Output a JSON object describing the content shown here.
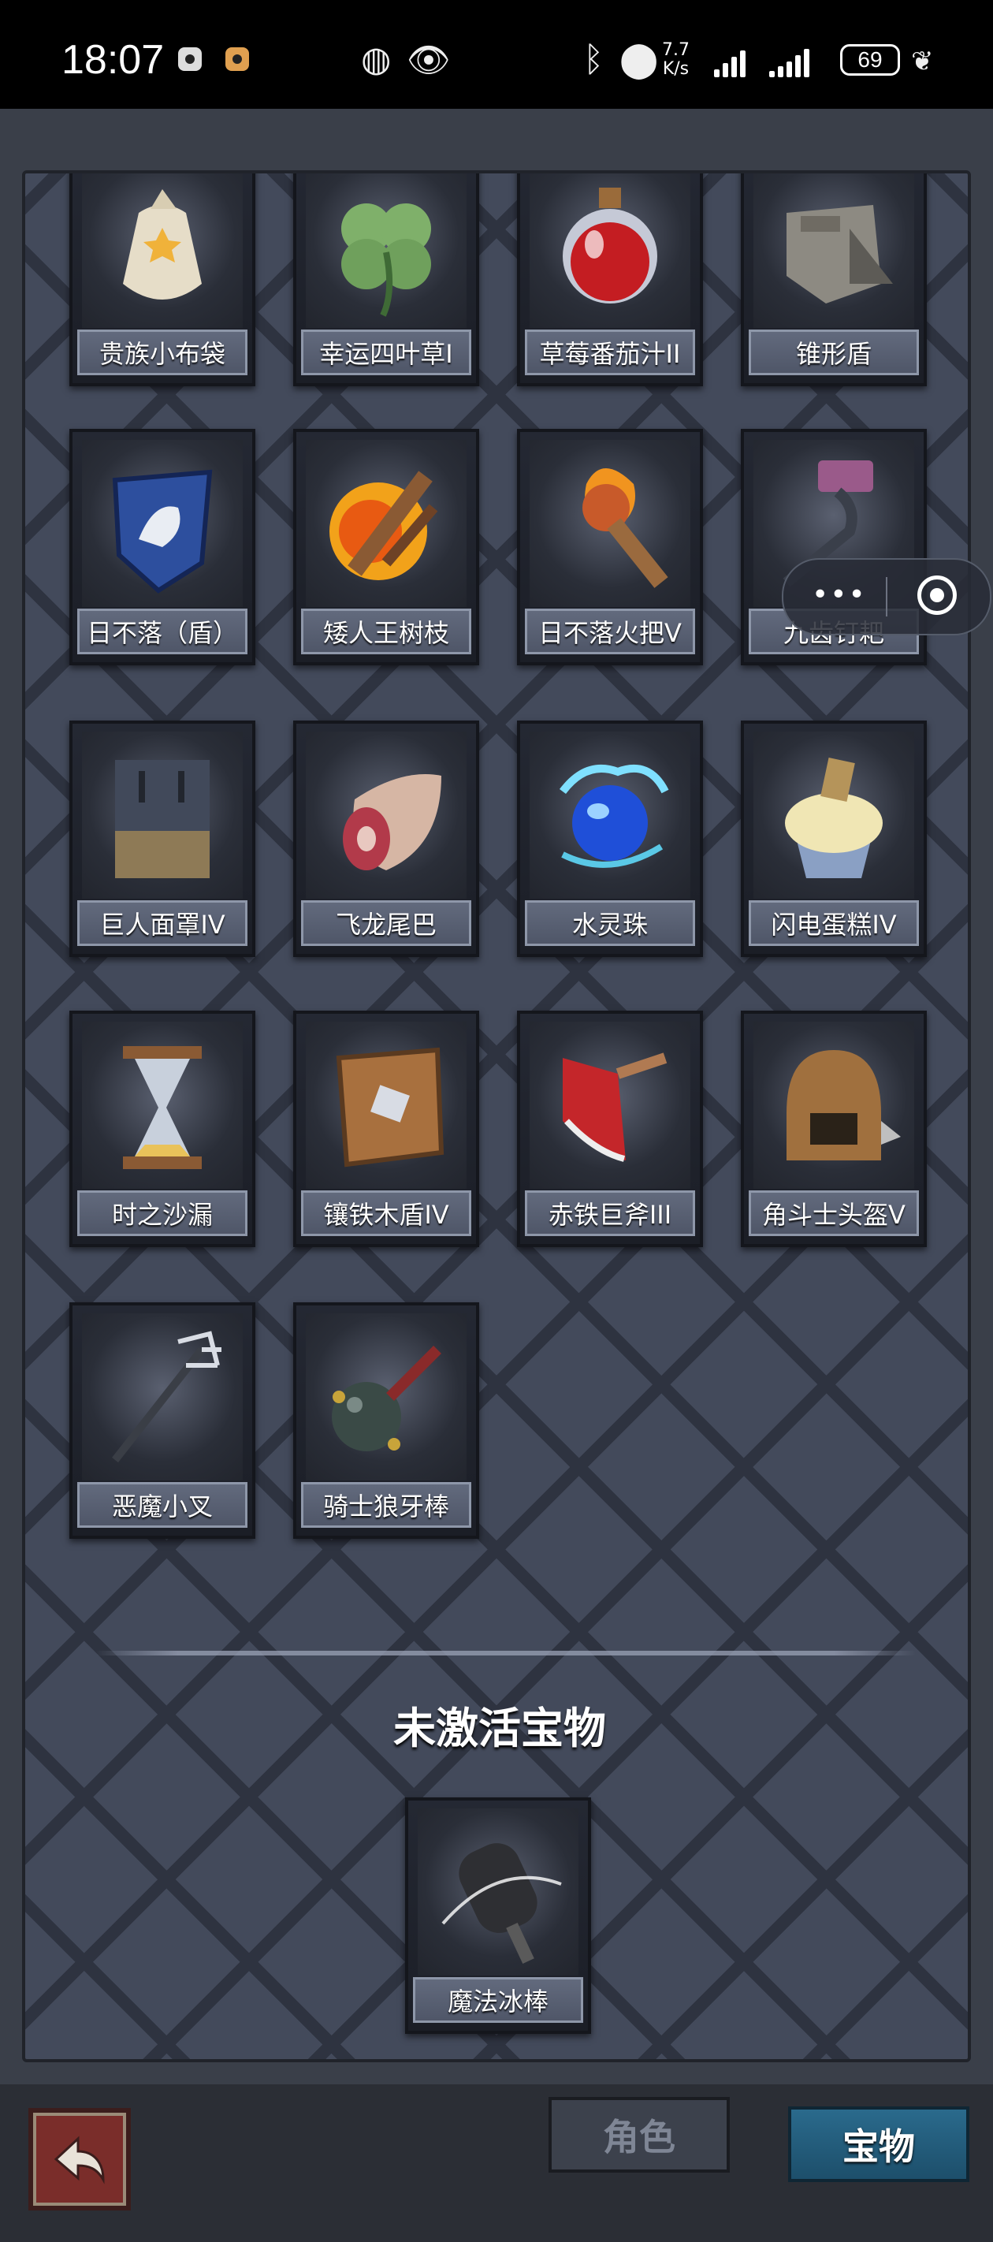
{
  "status_bar": {
    "time": "18:07",
    "net_speed_value": "7.7",
    "net_speed_unit": "K/s",
    "battery": "69"
  },
  "active_items": [
    {
      "name": "贵族小布袋",
      "icon": "cloth-pouch-icon"
    },
    {
      "name": "幸运四叶草I",
      "icon": "four-leaf-clover-icon"
    },
    {
      "name": "草莓番茄汁II",
      "icon": "red-potion-icon"
    },
    {
      "name": "锥形盾",
      "icon": "spiked-shield-icon"
    },
    {
      "name": "日不落（盾）",
      "icon": "lion-shield-icon"
    },
    {
      "name": "矮人王树枝",
      "icon": "flaming-branch-icon"
    },
    {
      "name": "日不落火把V",
      "icon": "torch-icon"
    },
    {
      "name": "九齿钉耙",
      "icon": "rake-icon"
    },
    {
      "name": "巨人面罩IV",
      "icon": "giant-mask-icon"
    },
    {
      "name": "飞龙尾巴",
      "icon": "dragon-tail-meat-icon"
    },
    {
      "name": "水灵珠",
      "icon": "water-orb-icon"
    },
    {
      "name": "闪电蛋糕IV",
      "icon": "cupcake-icon"
    },
    {
      "name": "时之沙漏",
      "icon": "hourglass-icon"
    },
    {
      "name": "镶铁木盾IV",
      "icon": "wooden-shield-icon"
    },
    {
      "name": "赤铁巨斧III",
      "icon": "red-axe-icon"
    },
    {
      "name": "角斗士头盔V",
      "icon": "gladiator-helmet-icon"
    },
    {
      "name": "恶魔小叉",
      "icon": "trident-icon"
    },
    {
      "name": "骑士狼牙棒",
      "icon": "mace-icon"
    }
  ],
  "inactive_title": "未激活宝物",
  "inactive_items": [
    {
      "name": "魔法冰棒",
      "icon": "ice-pop-icon"
    }
  ],
  "tabs": {
    "role": "角色",
    "treasure": "宝物"
  }
}
